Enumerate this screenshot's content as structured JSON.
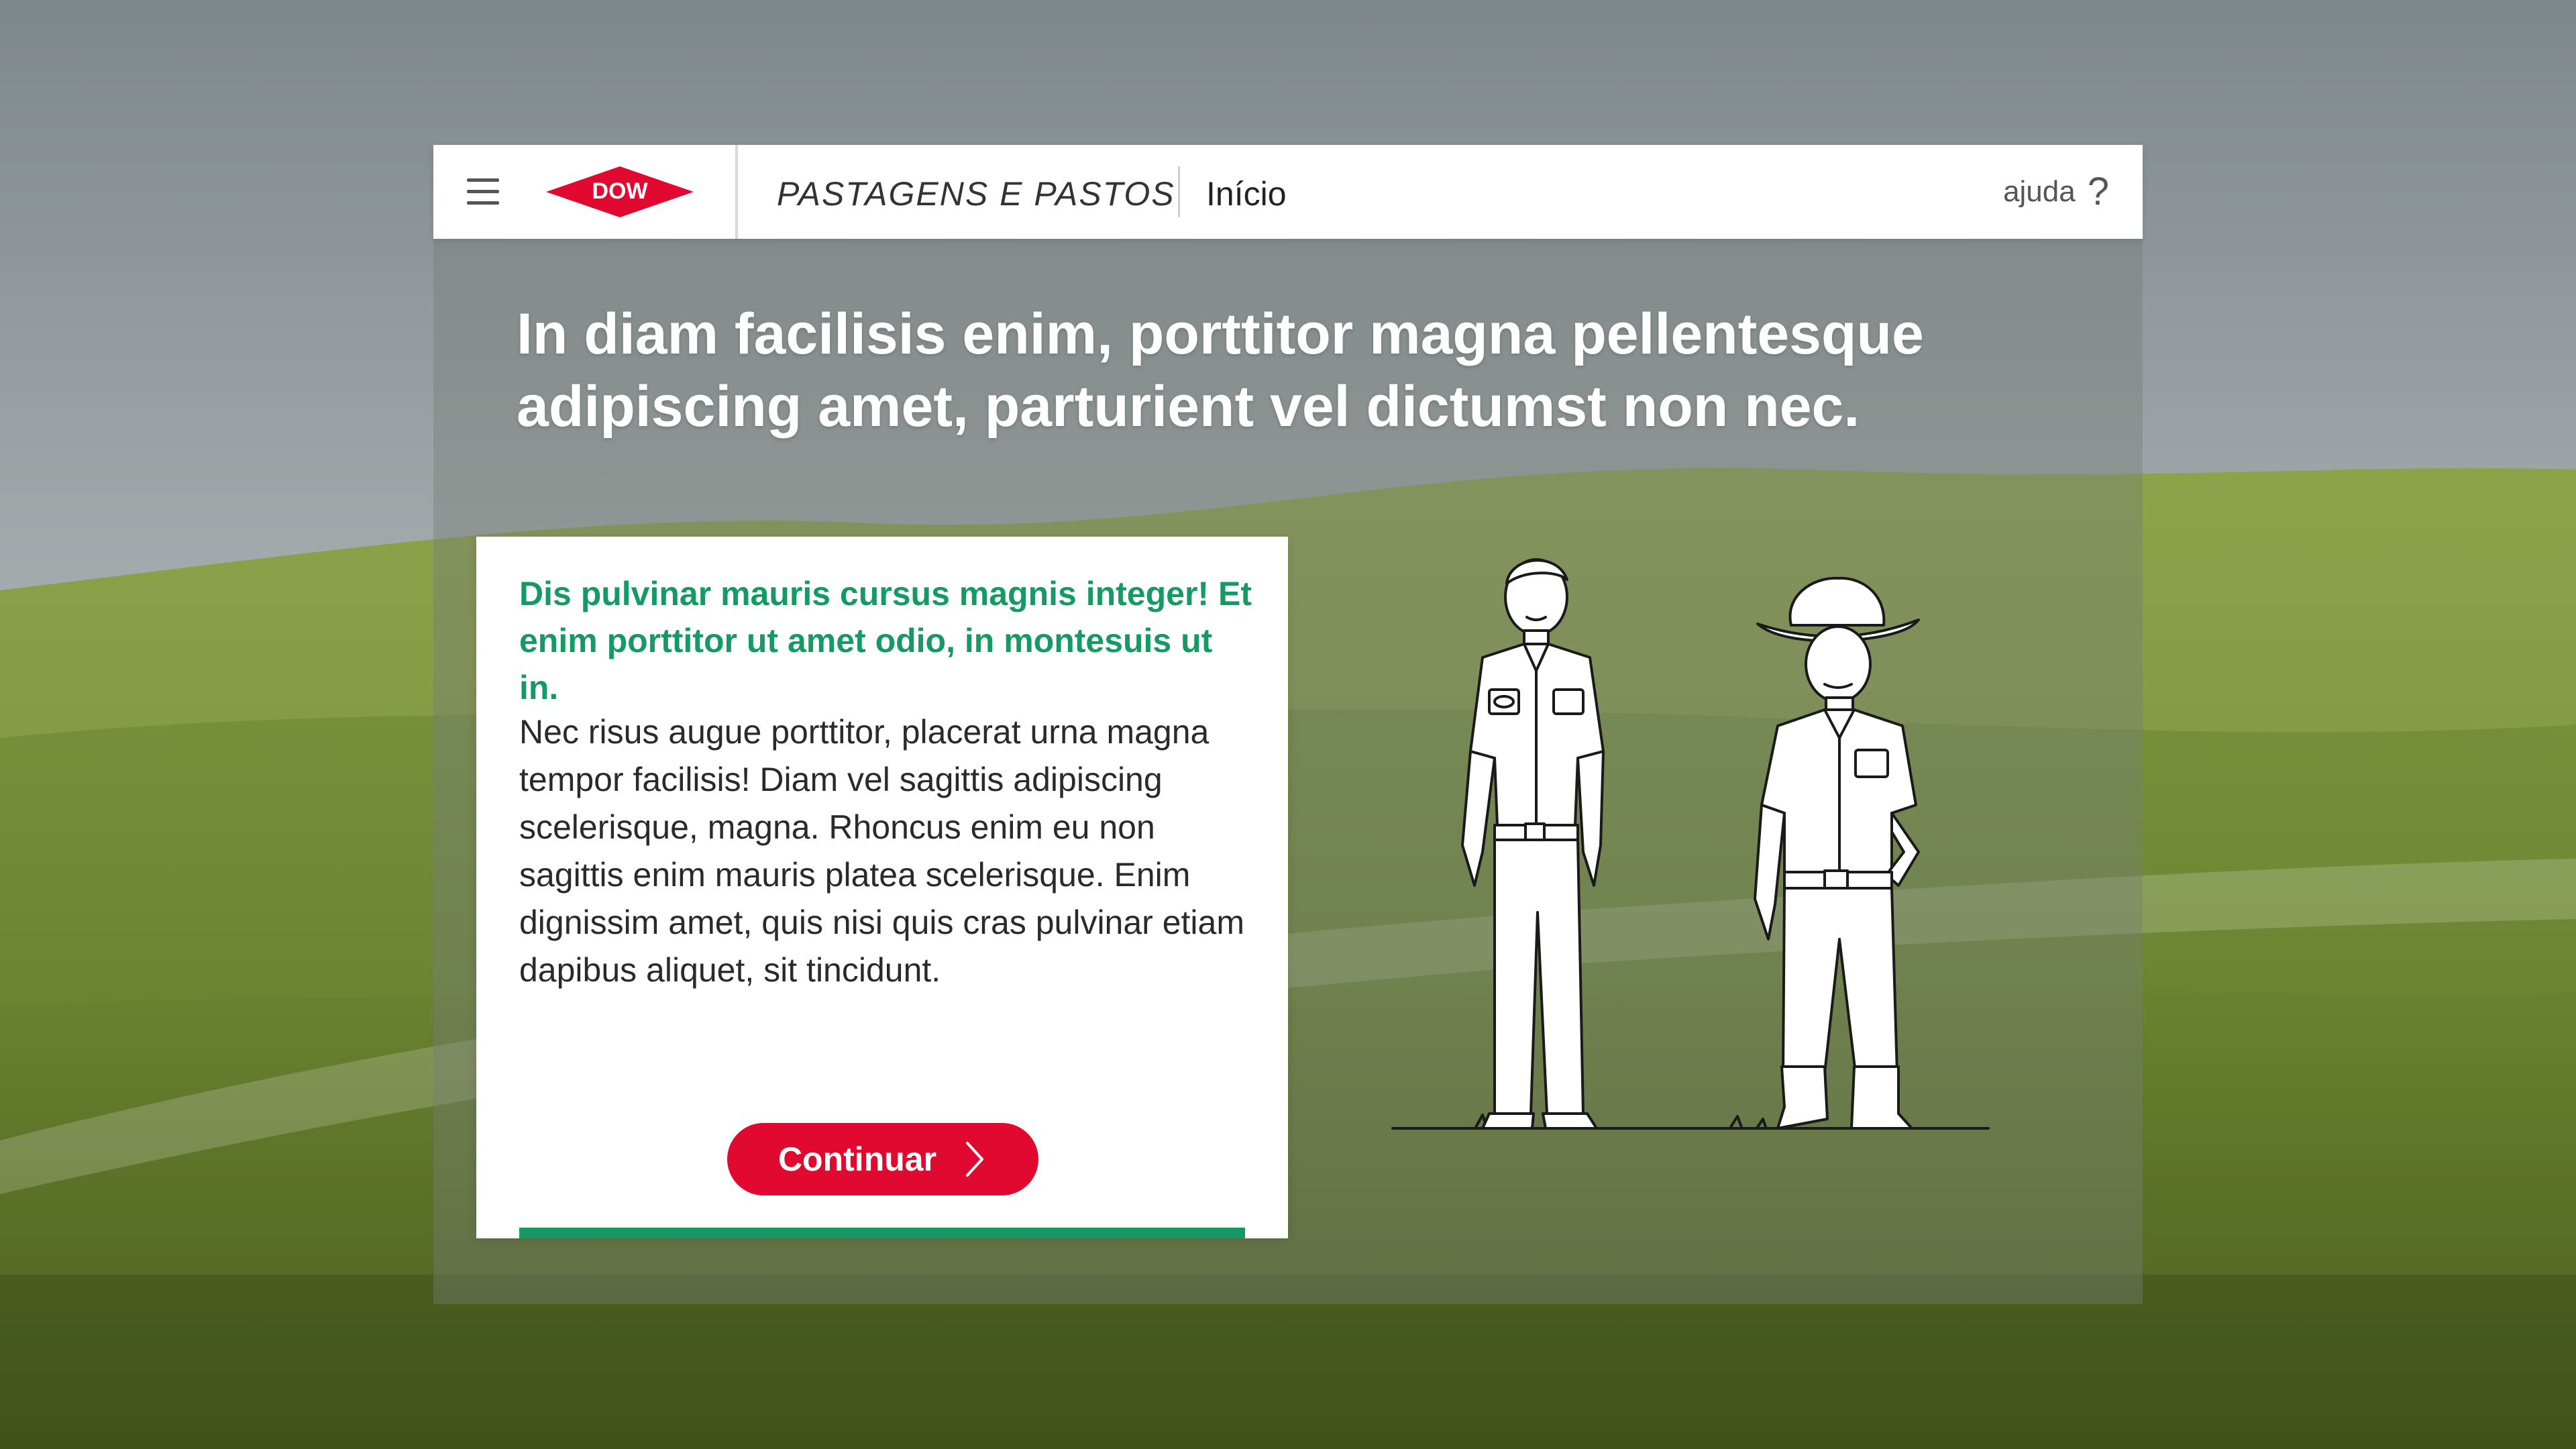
{
  "header": {
    "section_title": "PASTAGENS E PASTOS",
    "breadcrumb": "Início",
    "help_label": "ajuda",
    "help_icon": "question-mark-icon",
    "menu_icon": "hamburger-menu-icon",
    "logo_text": "DOW"
  },
  "main": {
    "headline": "In diam facilisis enim, porttitor magna pellentesque adipiscing amet, parturient vel dictumst non nec.",
    "card": {
      "subtitle": "Dis pulvinar mauris cursus magnis integer! Et enim porttitor ut amet odio, in montesuis ut in.",
      "body": "Nec risus augue porttitor, placerat urna magna tempor facilisis! Diam vel sagittis adipiscing scelerisque, magna. Rhoncus enim eu non sagittis enim mauris platea scelerisque. Enim dignissim amet, quis nisi quis cras pulvinar etiam dapibus aliquet, sit tincidunt.",
      "continue_label": "Continuar",
      "progress": 1.0
    }
  },
  "colors": {
    "brand_red": "#e1092f",
    "accent_green": "#159a63",
    "panel_overlay": "rgba(120,126,118,0.42)"
  }
}
